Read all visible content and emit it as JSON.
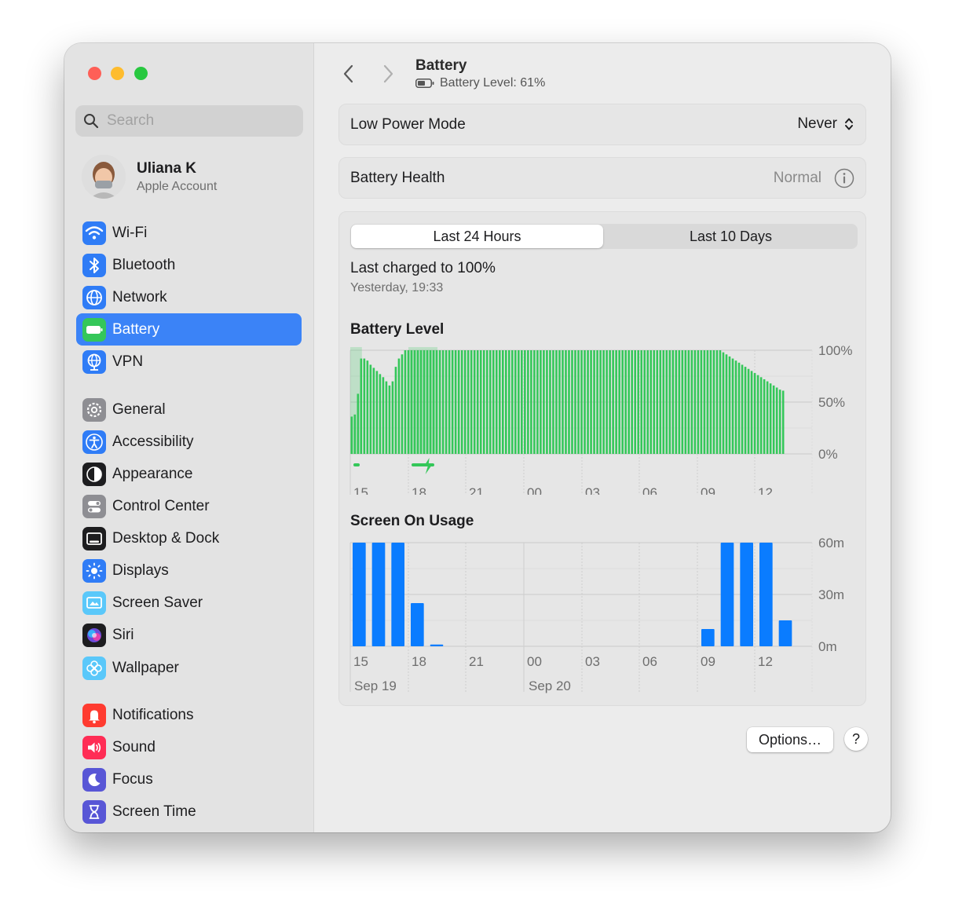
{
  "sidebar": {
    "search_placeholder": "Search",
    "account": {
      "name": "Uliana K",
      "subtitle": "Apple Account"
    },
    "groups": [
      [
        {
          "label": "Wi-Fi",
          "icon": "wifi-icon",
          "color": "#2f7cf6"
        },
        {
          "label": "Bluetooth",
          "icon": "bluetooth-icon",
          "color": "#2f7cf6"
        },
        {
          "label": "Network",
          "icon": "globe-icon",
          "color": "#2f7cf6"
        },
        {
          "label": "Battery",
          "icon": "battery-icon",
          "color": "#34c759",
          "selected": true
        },
        {
          "label": "VPN",
          "icon": "vpn-globe-icon",
          "color": "#2f7cf6"
        }
      ],
      [
        {
          "label": "General",
          "icon": "gear-icon",
          "color": "#8e8e93"
        },
        {
          "label": "Accessibility",
          "icon": "accessibility-icon",
          "color": "#2f7cf6"
        },
        {
          "label": "Appearance",
          "icon": "appearance-icon",
          "color": "#1d1d1f"
        },
        {
          "label": "Control Center",
          "icon": "control-center-icon",
          "color": "#8e8e93"
        },
        {
          "label": "Desktop & Dock",
          "icon": "desktop-dock-icon",
          "color": "#1d1d1f"
        },
        {
          "label": "Displays",
          "icon": "sun-icon",
          "color": "#2f7cf6"
        },
        {
          "label": "Screen Saver",
          "icon": "screen-saver-icon",
          "color": "#5ac8fa"
        },
        {
          "label": "Siri",
          "icon": "siri-icon",
          "color": "#1d1d1f"
        },
        {
          "label": "Wallpaper",
          "icon": "wallpaper-flower-icon",
          "color": "#5ac8fa"
        }
      ],
      [
        {
          "label": "Notifications",
          "icon": "bell-icon",
          "color": "#ff3b30"
        },
        {
          "label": "Sound",
          "icon": "speaker-icon",
          "color": "#ff2d55"
        },
        {
          "label": "Focus",
          "icon": "moon-icon",
          "color": "#5856d6"
        },
        {
          "label": "Screen Time",
          "icon": "hourglass-icon",
          "color": "#5856d6"
        }
      ]
    ]
  },
  "header": {
    "title": "Battery",
    "battery_level": "Battery Level: 61%"
  },
  "low_power": {
    "label": "Low Power Mode",
    "value": "Never"
  },
  "health": {
    "label": "Battery Health",
    "value": "Normal"
  },
  "usage": {
    "tabs": [
      "Last 24 Hours",
      "Last 10 Days"
    ],
    "selected_tab": 0,
    "last_charged": "Last charged to 100%",
    "last_charged_time": "Yesterday, 19:33",
    "battery_chart_title": "Battery Level",
    "screen_chart_title": "Screen On Usage"
  },
  "chart_data": [
    {
      "type": "bar",
      "title": "Battery Level",
      "x_ticks": [
        "15",
        "18",
        "21",
        "00",
        "03",
        "06",
        "09",
        "12"
      ],
      "y_ticks": [
        "100%",
        "50%",
        "0%"
      ],
      "ylim": [
        0,
        100
      ],
      "color": "#34c759",
      "charging_color": "#34c759",
      "values": [
        36,
        38,
        58,
        92,
        92,
        90,
        86,
        83,
        80,
        77,
        74,
        70,
        66,
        70,
        84,
        92,
        96,
        100,
        100,
        100,
        100,
        100,
        100,
        100,
        100,
        100,
        100,
        100,
        100,
        100,
        100,
        100,
        100,
        100,
        100,
        100,
        100,
        100,
        100,
        100,
        100,
        100,
        100,
        100,
        100,
        100,
        100,
        100,
        100,
        100,
        100,
        100,
        100,
        100,
        100,
        100,
        100,
        100,
        100,
        100,
        100,
        100,
        100,
        100,
        100,
        100,
        100,
        100,
        100,
        100,
        100,
        100,
        100,
        100,
        100,
        100,
        100,
        100,
        100,
        100,
        100,
        100,
        100,
        100,
        100,
        100,
        100,
        100,
        100,
        100,
        100,
        100,
        100,
        100,
        100,
        100,
        100,
        100,
        100,
        100,
        100,
        100,
        100,
        100,
        100,
        100,
        100,
        100,
        100,
        100,
        100,
        100,
        100,
        100,
        100,
        100,
        100,
        100,
        98,
        96,
        94,
        92,
        90,
        88,
        86,
        84,
        82,
        80,
        78,
        76,
        74,
        72,
        70,
        68,
        66,
        64,
        62,
        61
      ],
      "charging_periods": [
        [
          0.0,
          0.6
        ],
        [
          3.0,
          4.5
        ]
      ]
    },
    {
      "type": "bar",
      "title": "Screen On Usage",
      "x_ticks": [
        "15",
        "18",
        "21",
        "00",
        "03",
        "06",
        "09",
        "12"
      ],
      "x_day_labels": [
        {
          "label": "Sep 19",
          "at_hour_index": 0
        },
        {
          "label": "Sep 20",
          "at_hour_index": 9
        }
      ],
      "y_ticks": [
        "60m",
        "30m",
        "0m"
      ],
      "ylim": [
        0,
        60
      ],
      "color": "#0a7cff",
      "values_minutes": [
        60,
        60,
        60,
        25,
        1,
        0,
        0,
        0,
        0,
        0,
        0,
        0,
        0,
        0,
        0,
        0,
        0,
        0,
        10,
        60,
        60,
        60,
        15
      ]
    }
  ],
  "footer": {
    "options_label": "Options…",
    "help_label": "?"
  }
}
